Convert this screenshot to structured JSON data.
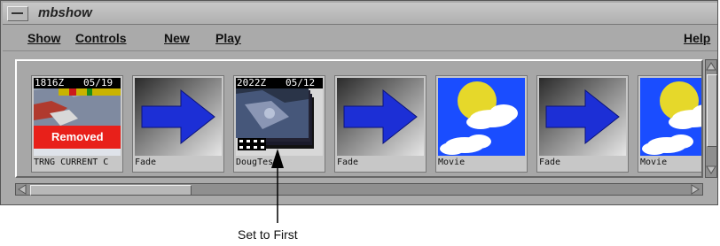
{
  "window": {
    "title": "mbshow"
  },
  "menubar": {
    "items": [
      "Show",
      "Controls",
      "New",
      "Play",
      "Help"
    ]
  },
  "thumbnails": [
    {
      "type": "image",
      "caption": "TRNG CURRENT C",
      "overlay_time": "1816Z",
      "overlay_date": "05/19",
      "banner": "Removed"
    },
    {
      "type": "transition",
      "caption": "Fade"
    },
    {
      "type": "image",
      "caption": "DougTest",
      "overlay_time": "2022Z",
      "overlay_date": "05/12"
    },
    {
      "type": "transition",
      "caption": "Fade"
    },
    {
      "type": "movie",
      "caption": "Movie"
    },
    {
      "type": "transition",
      "caption": "Fade"
    },
    {
      "type": "movie",
      "caption": "Movie"
    }
  ],
  "callout": {
    "label": "Set to First"
  },
  "colors": {
    "window_bg": "#aaaaaa",
    "removed_banner": "#e8201a",
    "arrow_blue": "#1c2fd6",
    "sky_blue": "#1a4dff",
    "sun_yellow": "#e6d82a"
  }
}
